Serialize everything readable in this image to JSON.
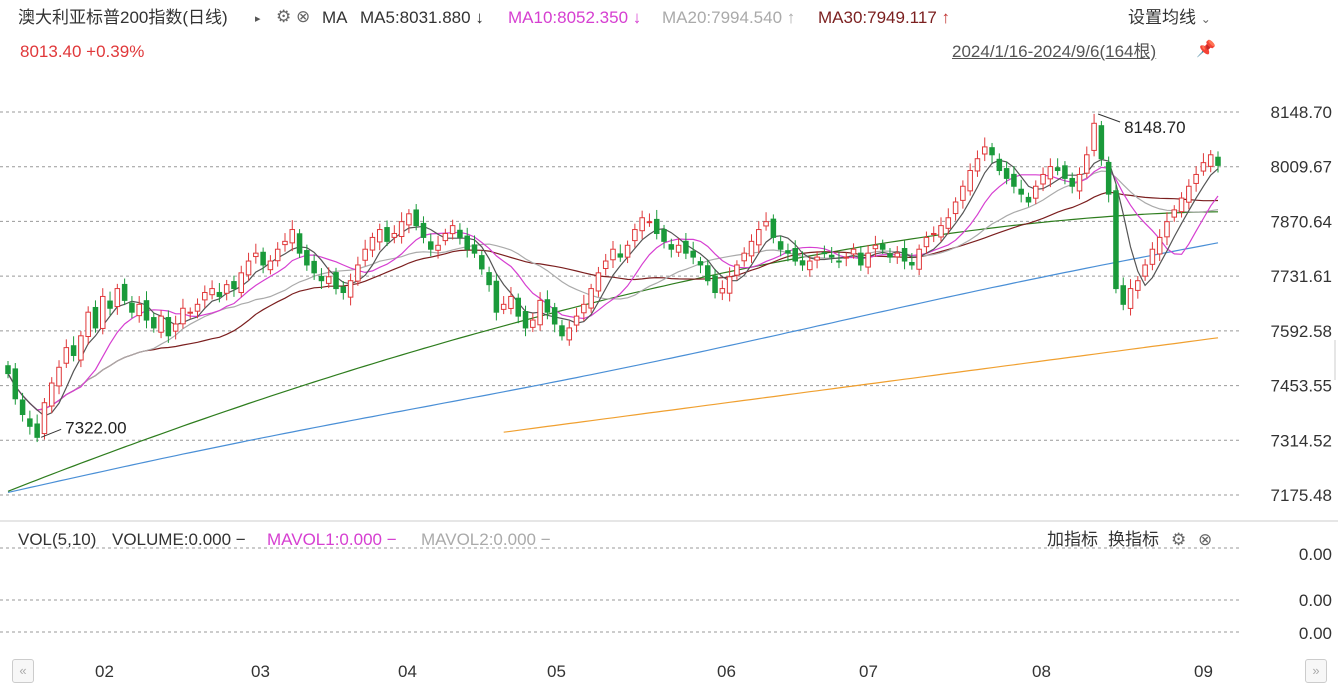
{
  "header": {
    "title": "澳大利亚标普200指数(日线)",
    "ma_label": "MA",
    "ma5": "MA5:8031.880",
    "ma10": "MA10:8052.350",
    "ma20": "MA20:7994.540",
    "ma30": "MA30:7949.117",
    "ma5_dir": "↓",
    "ma10_dir": "↓",
    "ma20_dir": "↑",
    "ma30_dir": "↑",
    "settings_label": "设置均线",
    "price": "8013.40 +0.39%",
    "range": "2024/1/16-2024/9/6(164根)"
  },
  "volume_panel": {
    "label": "VOL(5,10)",
    "volume": "VOLUME:0.000",
    "mavol1": "MAVOL1:0.000",
    "mavol2": "MAVOL2:0.000",
    "add_indicator": "加指标",
    "switch_indicator": "换指标",
    "y_ticks": [
      "0.00",
      "0.00",
      "0.00"
    ]
  },
  "colors": {
    "up": "#e0383a",
    "down": "#1a9a3a",
    "ma5": "#555555",
    "ma10": "#d63fd1",
    "ma20": "#aaaaaa",
    "ma30": "#7b1f1f",
    "ma60": "#2e7d1e",
    "ma120": "#4a8fd6",
    "ma250": "#f0a030"
  },
  "chart_data": {
    "type": "candlestick",
    "y_ticks": [
      "8148.70",
      "8009.67",
      "7870.64",
      "7731.61",
      "7592.58",
      "7453.55",
      "7314.52",
      "7175.48"
    ],
    "ylim": [
      7175.48,
      8148.7
    ],
    "x_ticks": [
      "02",
      "03",
      "04",
      "05",
      "06",
      "07",
      "08",
      "09"
    ],
    "annotations": [
      {
        "label": "8148.70",
        "value": 8148.7,
        "note": "high"
      },
      {
        "label": "7322.00",
        "value": 7322.0,
        "note": "low"
      }
    ],
    "candles_count": 164,
    "close_path": [
      7484,
      7420,
      7380,
      7350,
      7322,
      7410,
      7460,
      7500,
      7550,
      7530,
      7580,
      7640,
      7600,
      7680,
      7650,
      7700,
      7670,
      7640,
      7660,
      7620,
      7600,
      7630,
      7580,
      7610,
      7650,
      7640,
      7660,
      7690,
      7700,
      7680,
      7710,
      7700,
      7740,
      7770,
      7790,
      7760,
      7770,
      7800,
      7820,
      7850,
      7790,
      7760,
      7740,
      7720,
      7730,
      7700,
      7690,
      7720,
      7760,
      7800,
      7830,
      7850,
      7820,
      7840,
      7870,
      7890,
      7860,
      7830,
      7800,
      7810,
      7840,
      7860,
      7830,
      7800,
      7790,
      7750,
      7710,
      7640,
      7660,
      7680,
      7630,
      7600,
      7620,
      7670,
      7640,
      7610,
      7580,
      7600,
      7630,
      7660,
      7700,
      7740,
      7770,
      7800,
      7780,
      7810,
      7850,
      7880,
      7870,
      7840,
      7820,
      7800,
      7810,
      7790,
      7780,
      7760,
      7720,
      7690,
      7700,
      7730,
      7760,
      7790,
      7820,
      7850,
      7870,
      7830,
      7800,
      7790,
      7770,
      7760,
      7770,
      7780,
      7790,
      7780,
      7770,
      7780,
      7800,
      7760,
      7790,
      7810,
      7800,
      7780,
      7790,
      7770,
      7760,
      7800,
      7830,
      7840,
      7860,
      7880,
      7920,
      7960,
      8000,
      8030,
      8060,
      8040,
      8000,
      7980,
      7960,
      7940,
      7920,
      7960,
      7990,
      8010,
      8000,
      7980,
      7960,
      7990,
      8040,
      8120,
      8030,
      7940,
      7700,
      7660,
      7700,
      7720,
      7760,
      7800,
      7830,
      7870,
      7900,
      7930,
      7960,
      7990,
      8020,
      8040,
      8013
    ]
  }
}
